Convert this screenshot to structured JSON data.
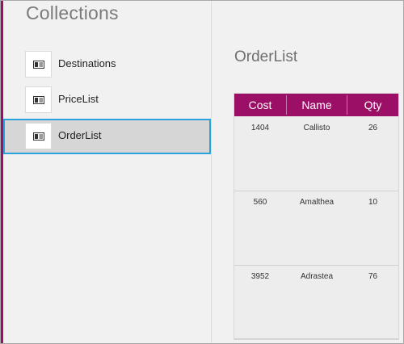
{
  "sidebar": {
    "title": "Collections",
    "items": [
      {
        "label": "Destinations",
        "icon": "table-icon",
        "selected": false
      },
      {
        "label": "PriceList",
        "icon": "table-icon",
        "selected": false
      },
      {
        "label": "OrderList",
        "icon": "table-icon",
        "selected": true
      }
    ]
  },
  "main": {
    "title": "OrderList",
    "table": {
      "headers": [
        "Cost",
        "Name",
        "Qty"
      ],
      "rows": [
        [
          "1404",
          "Callisto",
          "26"
        ],
        [
          "560",
          "Amalthea",
          "10"
        ],
        [
          "3952",
          "Adrastea",
          "76"
        ]
      ]
    }
  },
  "colors": {
    "accent": "#9c0f67",
    "selection": "#2aa2dc"
  }
}
